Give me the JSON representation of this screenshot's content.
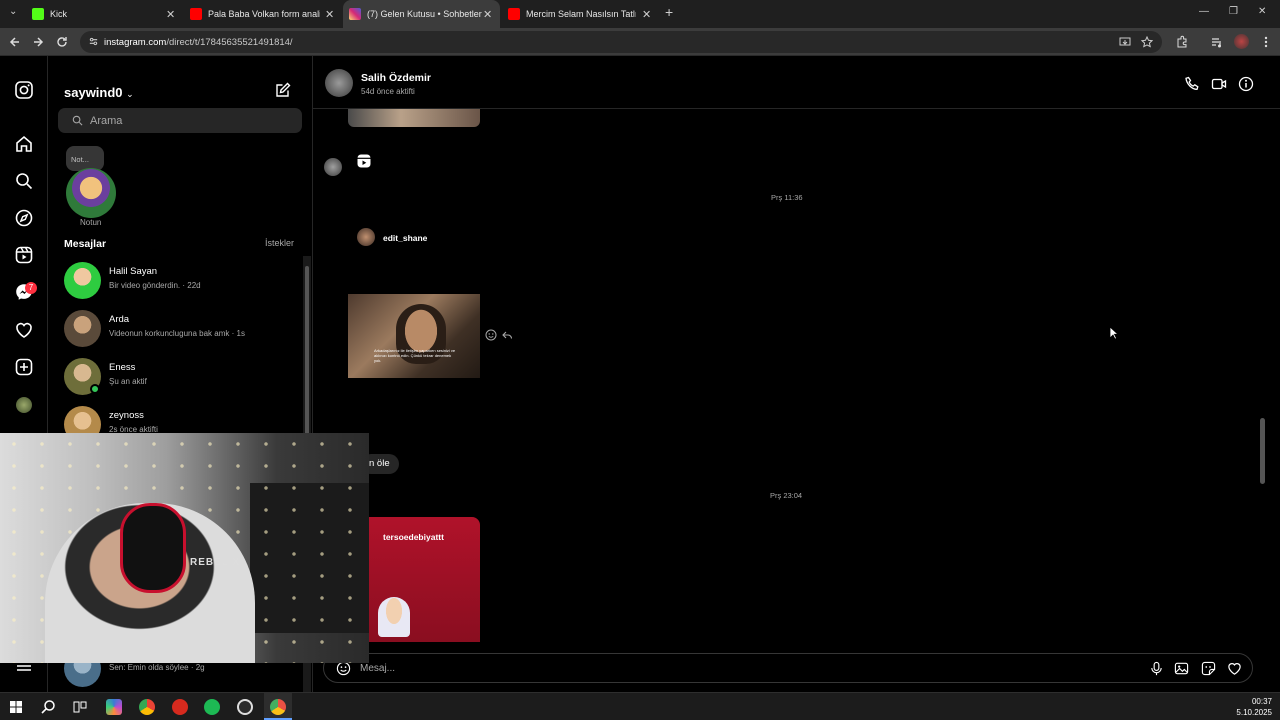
{
  "browser": {
    "tabs": [
      {
        "title": "Kick",
        "favicon_color": "#53fc18",
        "close": "✕"
      },
      {
        "title": "Pala Baba Volkan form analiz (a",
        "favicon_color": "#ff0000",
        "close": "✕"
      },
      {
        "title": "(7) Gelen Kutusu • Sohbetler",
        "favicon_color": "#d6249f",
        "close": "✕"
      },
      {
        "title": "Mercim Selam Nasılsın Tatlım ?",
        "favicon_color": "#ff0000",
        "close": "✕"
      }
    ],
    "new_tab": "+",
    "url_host": "instagram.com",
    "url_path": "/direct/t/17845635521491814/"
  },
  "sidebar": {
    "username": "saywind0",
    "search_placeholder": "Arama",
    "note_bubble": "Not...",
    "note_label": "Notun",
    "section_title": "Mesajlar",
    "requests_link": "İstekler",
    "notification_count": "7",
    "conversations": [
      {
        "name": "Halil Sayan",
        "preview": "Bir video gönderdin. · 22d",
        "avatar_color": "#2ecc40"
      },
      {
        "name": "Arda",
        "preview": "Videonun korkuncluguna bak amk · 1s",
        "avatar_color": "#5a4a3a"
      },
      {
        "name": "Eness",
        "preview": "Şu an aktif",
        "avatar_color": "#6e6e3a"
      },
      {
        "name": "zeynoss",
        "preview": "2s önce aktifti",
        "avatar_color": "#b48a4a"
      },
      {
        "name": "",
        "preview": "Sen: Emin olda söylee · 2g",
        "avatar_color": "#4a6e8a"
      }
    ]
  },
  "chat": {
    "contact_name": "Salih Özdemir",
    "contact_status": "54d önce aktifti",
    "timestamp_1": "Prş 11:36",
    "shared_user_1": "edit_shane",
    "video_caption": "Arkadaşlarınız ile iletişim yaparken sesinizi ve aklınızı kontrol edin. Çünkü tekrar denemek yok.",
    "bubble_text": "n öle",
    "timestamp_2": "Prş 23:04",
    "shared_user_2": "tersoedebiyattt",
    "composer_placeholder": "Mesaj..."
  },
  "webcam": {
    "headset_text": "REBEL X"
  },
  "taskbar": {
    "time": "00:37",
    "date": "5.10.2025"
  },
  "colors": {
    "background": "#000000",
    "divider": "#262626",
    "notification": "#ff3040",
    "online": "#34c759"
  }
}
